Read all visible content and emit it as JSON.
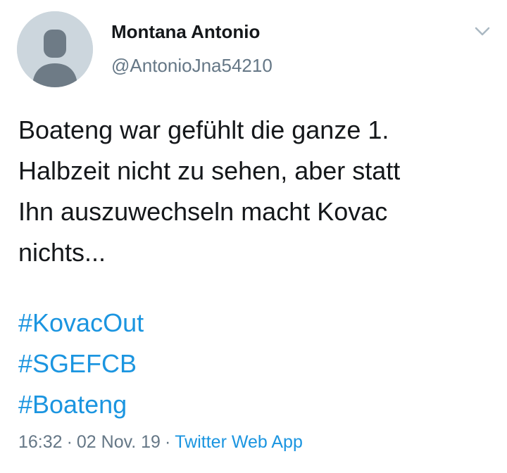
{
  "tweet": {
    "author": {
      "display_name": "Montana Antonio",
      "handle": "@AntonioJna54210",
      "avatar_icon": "default-profile-icon"
    },
    "menu_icon": "chevron-down-icon",
    "body_lines": [
      "Boateng war gefühlt die ganze 1.",
      "Halbzeit nicht zu sehen, aber statt",
      "Ihn auszuwechseln macht Kovac",
      "nichts..."
    ],
    "hashtags": [
      "#KovacOut",
      "#SGEFCB",
      "#Boateng"
    ],
    "time": "16:32",
    "separator": "·",
    "date": "02 Nov. 19",
    "source": "Twitter Web App"
  },
  "colors": {
    "text": "#14171a",
    "secondary": "#657786",
    "link": "#1b95e0",
    "avatar_bg": "#ccd6dd",
    "avatar_fg": "#6e7b86"
  }
}
